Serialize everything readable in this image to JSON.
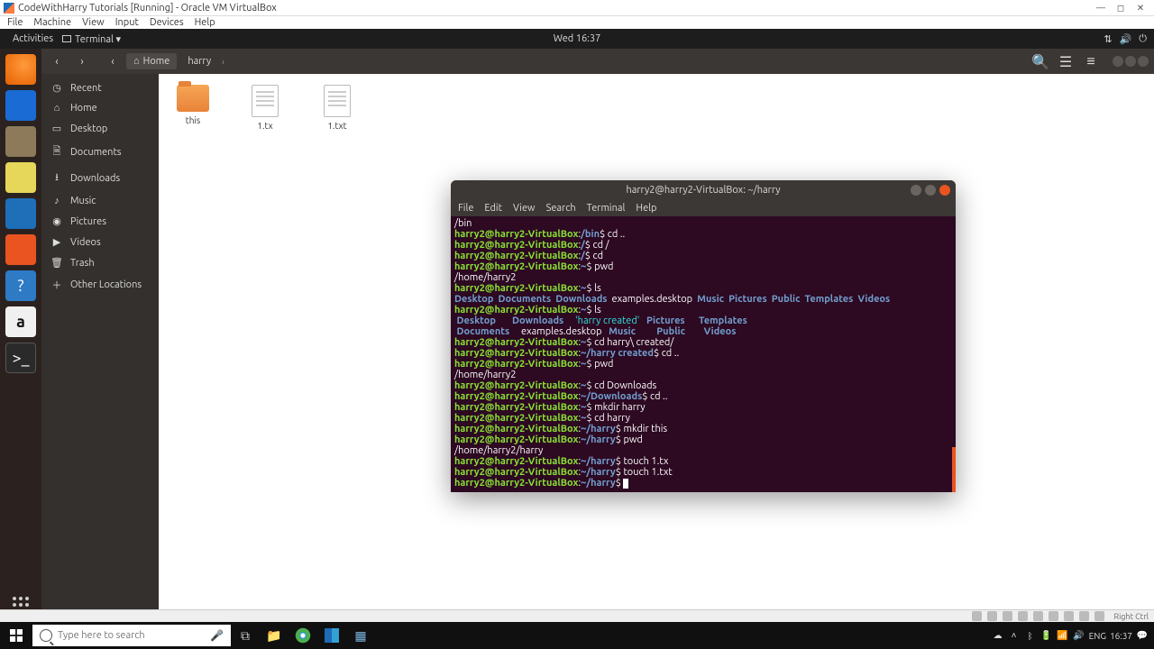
{
  "host": {
    "title": "CodeWithHarry Tutorials [Running] - Oracle VM VirtualBox",
    "menu": [
      "File",
      "Machine",
      "View",
      "Input",
      "Devices",
      "Help"
    ],
    "status_right": "Right Ctrl"
  },
  "ubuntu": {
    "activities": "Activities",
    "terminal_label": "Terminal ▾",
    "clock": "Wed 16:37"
  },
  "files": {
    "home_crumb": "Home",
    "path_crumb": "harry",
    "sidebar": [
      {
        "icon": "◷",
        "label": "Recent"
      },
      {
        "icon": "⌂",
        "label": "Home"
      },
      {
        "icon": "▭",
        "label": "Desktop"
      },
      {
        "icon": "🗎",
        "label": "Documents"
      },
      {
        "icon": "⭳",
        "label": "Downloads"
      },
      {
        "icon": "♪",
        "label": "Music"
      },
      {
        "icon": "◉",
        "label": "Pictures"
      },
      {
        "icon": "▶",
        "label": "Videos"
      },
      {
        "icon": "🗑",
        "label": "Trash"
      },
      {
        "icon": "＋",
        "label": "Other Locations"
      }
    ],
    "items": [
      {
        "type": "folder",
        "name": "this"
      },
      {
        "type": "doc",
        "name": "1.tx"
      },
      {
        "type": "doc",
        "name": "1.txt"
      }
    ]
  },
  "terminal": {
    "title": "harry2@harry2-VirtualBox: ~/harry",
    "menu": [
      "File",
      "Edit",
      "View",
      "Search",
      "Terminal",
      "Help"
    ],
    "user": "harry2@harry2-VirtualBox",
    "lines": [
      {
        "type": "out",
        "text": "/bin"
      },
      {
        "type": "prompt",
        "path": "/bin",
        "cmd": "cd .."
      },
      {
        "type": "prompt",
        "path": "/",
        "cmd": "cd /"
      },
      {
        "type": "prompt",
        "path": "/",
        "cmd": "cd"
      },
      {
        "type": "prompt",
        "path": "~",
        "cmd": "pwd"
      },
      {
        "type": "out",
        "text": "/home/harry2"
      },
      {
        "type": "prompt",
        "path": "~",
        "cmd": "ls"
      },
      {
        "type": "ls1"
      },
      {
        "type": "prompt",
        "path": "~",
        "cmd": "ls"
      },
      {
        "type": "ls2a"
      },
      {
        "type": "ls2b"
      },
      {
        "type": "prompt",
        "path": "~",
        "cmd": "cd harry\\ created/"
      },
      {
        "type": "prompt",
        "path": "~/harry created",
        "cmd": "cd .."
      },
      {
        "type": "prompt",
        "path": "~",
        "cmd": "pwd"
      },
      {
        "type": "out",
        "text": "/home/harry2"
      },
      {
        "type": "prompt",
        "path": "~",
        "cmd": "cd Downloads"
      },
      {
        "type": "prompt",
        "path": "~/Downloads",
        "cmd": "cd .."
      },
      {
        "type": "prompt",
        "path": "~",
        "cmd": "mkdir harry"
      },
      {
        "type": "prompt",
        "path": "~",
        "cmd": "cd harry"
      },
      {
        "type": "prompt",
        "path": "~/harry",
        "cmd": "mkdir this"
      },
      {
        "type": "prompt",
        "path": "~/harry",
        "cmd": "pwd"
      },
      {
        "type": "out",
        "text": "/home/harry2/harry"
      },
      {
        "type": "prompt",
        "path": "~/harry",
        "cmd": "touch 1.tx"
      },
      {
        "type": "prompt",
        "path": "~/harry",
        "cmd": "touch 1.txt"
      },
      {
        "type": "prompt",
        "path": "~/harry",
        "cmd": "",
        "cursor": true
      }
    ],
    "ls1": {
      "dirs": [
        "Desktop",
        "Documents",
        "Downloads"
      ],
      "file": "examples.desktop",
      "dirs2": [
        "Music",
        "Pictures",
        "Public",
        "Templates",
        "Videos"
      ]
    },
    "ls2": {
      "rowA": [
        {
          "t": "Desktop",
          "c": "dir"
        },
        {
          "t": "Downloads",
          "c": "dir"
        },
        {
          "t": "'harry created'",
          "c": "quoted"
        },
        {
          "t": "Pictures",
          "c": "dir"
        },
        {
          "t": "Templates",
          "c": "dir"
        }
      ],
      "rowB": [
        {
          "t": "Documents",
          "c": "dir"
        },
        {
          "t": "examples.desktop",
          "c": "file"
        },
        {
          "t": "Music",
          "c": "dir"
        },
        {
          "t": "Public",
          "c": "dir"
        },
        {
          "t": "Videos",
          "c": "dir"
        }
      ]
    }
  },
  "taskbar": {
    "search_placeholder": "Type here to search",
    "tray": {
      "lang": "ENG",
      "time": "16:37",
      "date": ""
    }
  }
}
